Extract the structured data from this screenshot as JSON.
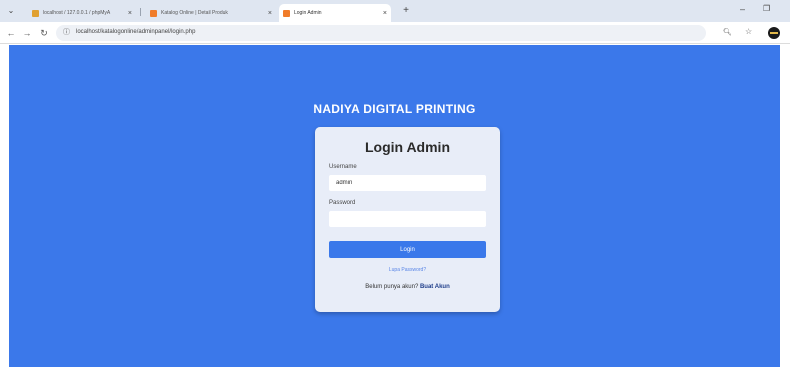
{
  "browser": {
    "tabs": [
      {
        "title": "localhost / 127.0.0.1 / phpMyA",
        "favicon": "phpmyadmin-icon",
        "color": "#e0a030",
        "active": false
      },
      {
        "title": "Katalog Online | Detail Produk",
        "favicon": "page-icon",
        "color": "#f07c2a",
        "active": false
      },
      {
        "title": "Login Admin",
        "favicon": "page-icon",
        "color": "#f07c2a",
        "active": true
      }
    ],
    "url": "localhost/katalogonline/adminpanel/login.php"
  },
  "page": {
    "background": "#3b78ea",
    "brand": "NADIYA DIGITAL PRINTING",
    "login": {
      "title": "Login Admin",
      "username_label": "Username",
      "username_value": "admin",
      "password_label": "Password",
      "password_value": "",
      "submit_label": "Login",
      "forgot_label": "Lupa Password?",
      "register_prompt": "Belum punya akun?",
      "register_link": "Buat Akun"
    }
  }
}
